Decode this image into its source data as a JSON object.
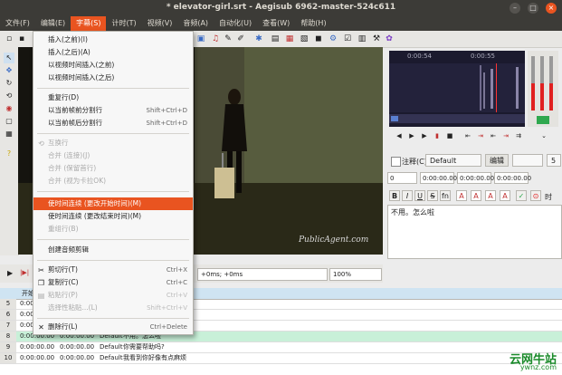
{
  "window": {
    "title": "* elevator-girl.srt - Aegisub 6962-master-524c611"
  },
  "menubar": {
    "items": [
      "文件(F)",
      "编辑(E)",
      "字幕(S)",
      "计时(T)",
      "视频(V)",
      "音频(A)",
      "自动化(U)",
      "查看(W)",
      "帮助(H)"
    ]
  },
  "context_menu": {
    "items": [
      {
        "label": "插入(之前)(I)",
        "shortcut": "",
        "disabled": false
      },
      {
        "label": "插入(之后)(A)",
        "shortcut": "",
        "disabled": false
      },
      {
        "label": "以视频时间插入(之前)",
        "shortcut": "",
        "disabled": false
      },
      {
        "label": "以视频时间插入(之后)",
        "shortcut": "",
        "disabled": false
      },
      {
        "label": "重复行(D)",
        "shortcut": "",
        "disabled": false
      },
      {
        "label": "以当前帧前分割行",
        "shortcut": "Shift+Ctrl+D",
        "disabled": false
      },
      {
        "label": "以当前帧后分割行",
        "shortcut": "Shift+Ctrl+D",
        "disabled": false
      },
      {
        "label": "互换行",
        "shortcut": "",
        "disabled": true
      },
      {
        "label": "合并 (连接)(J)",
        "shortcut": "",
        "disabled": true
      },
      {
        "label": "合并 (保留首行)",
        "shortcut": "",
        "disabled": true
      },
      {
        "label": "合并 (视为卡拉OK)",
        "shortcut": "",
        "disabled": true
      },
      {
        "label": "使时间连续 (更改开始时间)(M)",
        "shortcut": "",
        "disabled": false
      },
      {
        "label": "使时间连续 (更改结束时间)(M)",
        "shortcut": "",
        "disabled": false
      },
      {
        "label": "重组行(B)",
        "shortcut": "",
        "disabled": true
      },
      {
        "label": "创建音频剪辑",
        "shortcut": "",
        "disabled": false
      },
      {
        "label": "剪切行(T)",
        "shortcut": "Ctrl+X",
        "disabled": false
      },
      {
        "label": "复制行(C)",
        "shortcut": "Ctrl+C",
        "disabled": false
      },
      {
        "label": "粘贴行(P)",
        "shortcut": "Ctrl+V",
        "disabled": true
      },
      {
        "label": "选择性粘贴...(L)",
        "shortcut": "Shift+Ctrl+V",
        "disabled": true
      },
      {
        "label": "删除行(L)",
        "shortcut": "Ctrl+Delete",
        "disabled": false
      }
    ]
  },
  "video": {
    "watermark": "PublicAgent.com",
    "zoom": "100%",
    "time_offset": "+0ms; +0ms"
  },
  "audio": {
    "time_left": "0:00:54",
    "time_right": "0:00:55"
  },
  "editor": {
    "comment_label": "注释(C)",
    "style": "Default",
    "edit_button": "编辑",
    "layer": "5",
    "start_time": "0:00:00.00",
    "end_time": "0:00:00.00",
    "duration": "0:00:00.00",
    "margin_l": "0",
    "text": "不用。怎么啦",
    "time_label": "时"
  },
  "grid": {
    "header_label": "开始",
    "rows": [
      {
        "num": "5",
        "start": "0:00:00.00",
        "end": "",
        "style": "",
        "text": ""
      },
      {
        "num": "6",
        "start": "0:00:00.00",
        "end": "",
        "style": "",
        "text": ""
      },
      {
        "num": "7",
        "start": "0:00:00.00",
        "end": "",
        "style": "",
        "text": ""
      },
      {
        "num": "8",
        "start": "0:00:00.00",
        "end": "0:00:00.00",
        "style": "Default",
        "text": "不用。怎么啦"
      },
      {
        "num": "9",
        "start": "0:00:00.00",
        "end": "0:00:00.00",
        "style": "Default",
        "text": "你需要帮助吗?"
      },
      {
        "num": "10",
        "start": "0:00:00.00",
        "end": "0:00:00.00",
        "style": "Default",
        "text": "我看到你好像有点麻烦"
      }
    ]
  },
  "corner_watermark": {
    "site": "云网牛站",
    "url": "ywnz.com"
  }
}
